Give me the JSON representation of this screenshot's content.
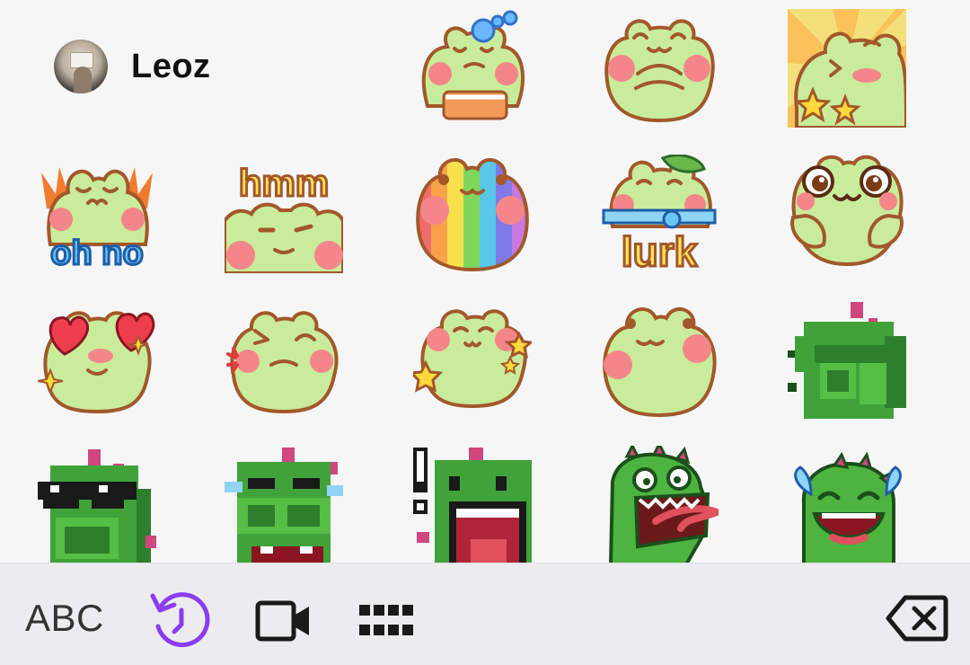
{
  "channel": {
    "name": "Leoz",
    "avatar_icon": "avatar"
  },
  "emotes": [
    {
      "id": "frog-bubbles",
      "label": ""
    },
    {
      "id": "frog-shy",
      "label": ""
    },
    {
      "id": "frog-stars-burst",
      "label": ""
    },
    {
      "id": "frog-ohno",
      "label": "oh no"
    },
    {
      "id": "frog-hmm",
      "label": "hmm"
    },
    {
      "id": "frog-rainbow",
      "label": ""
    },
    {
      "id": "frog-lurk",
      "label": "lurk"
    },
    {
      "id": "frog-owo",
      "label": ""
    },
    {
      "id": "frog-hearts",
      "label": ""
    },
    {
      "id": "frog-angry",
      "label": ""
    },
    {
      "id": "frog-sparkle",
      "label": ""
    },
    {
      "id": "frog-smile",
      "label": ""
    },
    {
      "id": "dino-facepalm",
      "label": ""
    },
    {
      "id": "dino-sunglasses",
      "label": ""
    },
    {
      "id": "dino-crying-pixel",
      "label": ""
    },
    {
      "id": "dino-shocked",
      "label": "!"
    },
    {
      "id": "dino-screaming",
      "label": ""
    },
    {
      "id": "dino-laughing-tears",
      "label": ""
    }
  ],
  "toolbar": {
    "abc_label": "ABC",
    "icons": [
      "recent-icon",
      "video-icon",
      "grid-icon",
      "delete-icon"
    ],
    "accent_color": "#8a3cf0"
  },
  "colors": {
    "frog_green": "#c9ec9a",
    "frog_outline": "#a2582a",
    "cheek_pink": "#f4868a",
    "dino_green": "#3fa33a"
  }
}
